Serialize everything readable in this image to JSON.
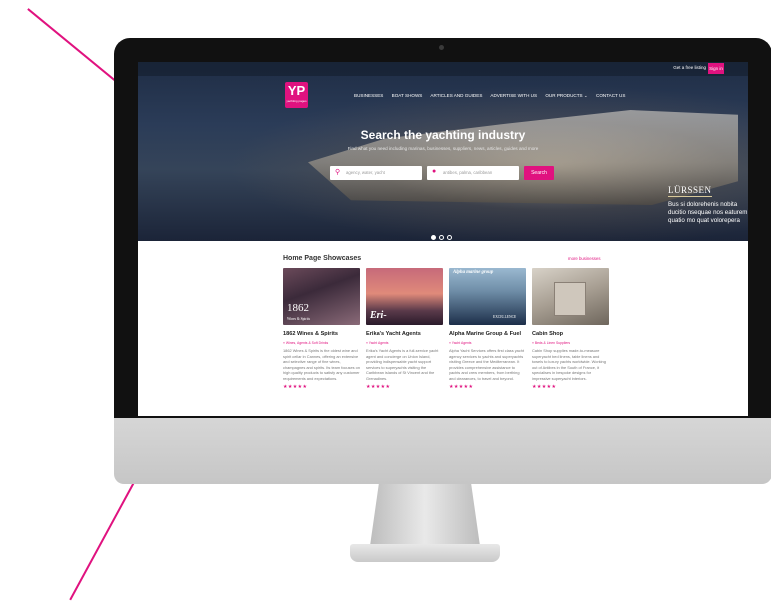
{
  "site": {
    "topbar": {
      "free_listing": "Get a free listing",
      "sign_in": "Sign in"
    },
    "logo": {
      "mark": "YP",
      "sub": "yachting pages"
    },
    "nav": [
      "BUSINESSES",
      "BOAT SHOWS",
      "ARTICLES AND GUIDES",
      "ADVERTISE WITH US",
      "OUR PRODUCTS ⌄",
      "CONTACT US"
    ],
    "hero": {
      "title": "Search the yachting industry",
      "subtitle": "Find what you need including marinas, businesses, suppliers, news, articles, guides and more",
      "search_placeholder": "agency, water, yacht",
      "location_placeholder": "antibes, palma, caribbean",
      "search_button": "Search"
    },
    "ad": {
      "brand": "LÜRSSEN",
      "copy": "Bus si dolorehenis nobita ducitio nsequae nos eaturem quatio mo quat volorepera"
    },
    "showcases": {
      "title": "Home Page Showcases",
      "view_all": "more businesses",
      "cards": [
        {
          "name": "1862 Wines & Spirits",
          "category": "» Wines, Agents & Soft Drinks",
          "image_text": "1862",
          "image_sub": "Wines & Spirits",
          "desc": "1862 Wines & Spirits is the oldest wine and spirit cellar in Cannes, offering an extensive and selective range of fine wines, champagnes and spirits. Its team focuses on high quality products to satisfy any customer requirements and expectations.",
          "stars": "★★★★★"
        },
        {
          "name": "Erika's Yacht Agents",
          "category": "» Yacht Agents",
          "image_text": "Eri-",
          "image_sub": "",
          "desc": "Erika's Yacht Agents is a full-service yacht agent and concierge on Union Island, providing indispensable yacht support services to superyachts visiting the Caribbean islands of St Vincent and the Grenadines.",
          "stars": "★★★★★"
        },
        {
          "name": "Alpha Marine Group & Fuel",
          "category": "» Yacht Agents",
          "image_text": "Alpha marine group",
          "image_sub": "EXCELLENCE",
          "desc": "Alpha Yacht Services offers first class yacht agency services to yachts and superyachts visiting Greece and the Mediterranean. It provides comprehensive assistance to yachts and crew members, from berthing and clearances, to travel and beyond.",
          "stars": "★★★★★"
        },
        {
          "name": "Cabin Shop",
          "category": "» Beds & Linen Suppliers",
          "image_text": "",
          "image_sub": "",
          "desc": "Cabin Shop supplies made-to-measure superyacht bed linens, table linens and towels to luxury yachts worldwide. Working out of Antibes in the South of France, it specialises in bespoke designs for impressive superyacht interiors.",
          "stars": "★★★★★"
        }
      ]
    }
  }
}
